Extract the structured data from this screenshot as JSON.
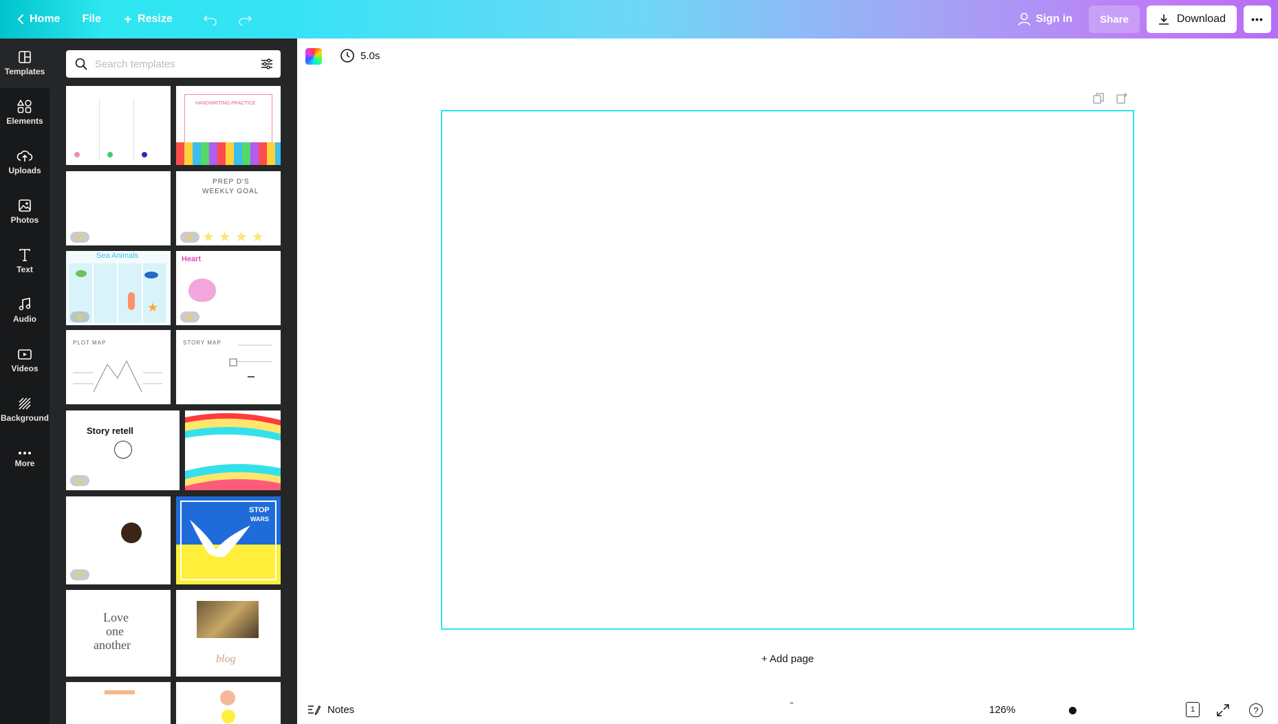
{
  "topbar": {
    "home_label": "Home",
    "file_label": "File",
    "resize_label": "Resize",
    "signin_label": "Sign in",
    "share_label": "Share",
    "download_label": "Download",
    "more_label": "•••"
  },
  "rail": {
    "items": [
      {
        "label": "Templates",
        "icon": "templates-icon"
      },
      {
        "label": "Elements",
        "icon": "elements-icon"
      },
      {
        "label": "Uploads",
        "icon": "uploads-icon"
      },
      {
        "label": "Photos",
        "icon": "photos-icon"
      },
      {
        "label": "Text",
        "icon": "text-icon"
      },
      {
        "label": "Audio",
        "icon": "audio-icon"
      },
      {
        "label": "Videos",
        "icon": "videos-icon"
      },
      {
        "label": "Background",
        "icon": "background-icon"
      },
      {
        "label": "More",
        "icon": "more-icon"
      }
    ]
  },
  "panel": {
    "search_placeholder": "Search templates",
    "thumbs": {
      "t2_title": "HANDWRITING PRACTICE",
      "t4_title_1": "PREP D'S",
      "t4_title_2": "WEEKLY GOAL",
      "t5_title": "Sea Animals",
      "t6_title": "Heart",
      "t7_title": "PLOT MAP",
      "t8_title": "STORY MAP",
      "t9_title": "Story retell",
      "t12_title_1": "STOP",
      "t12_title_2": "WARS",
      "t13_line1": "Love",
      "t13_line2": "one",
      "t13_line3": "another",
      "t14_title": "blog"
    },
    "crown_glyph": "♛"
  },
  "editor": {
    "duration": "5.0s",
    "add_page": "+ Add page",
    "notes_label": "Notes",
    "zoom": "126%",
    "page_count": "1",
    "help_glyph": "?",
    "caret_glyph": "⌃"
  },
  "colors": {
    "canvas_border": "#2ee6e9",
    "rail_bg": "#18191b",
    "panel_bg": "#252627"
  }
}
